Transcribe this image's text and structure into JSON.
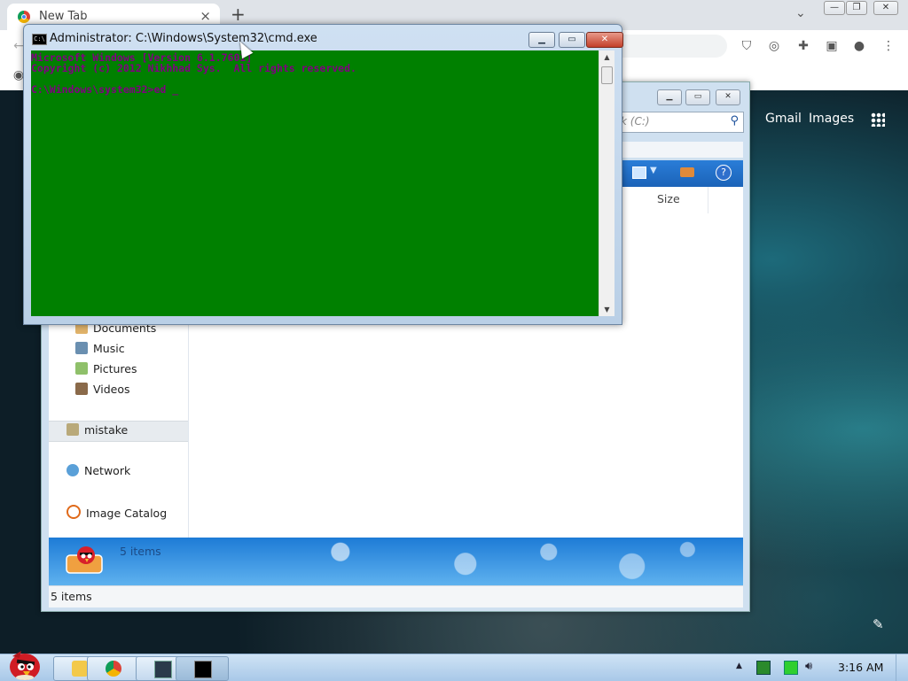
{
  "browser": {
    "tab_title": "New Tab",
    "tab_close": "×",
    "new_tab": "+",
    "tab_dropdown": "⌄",
    "ntp_links": [
      "Gmail",
      "Images"
    ]
  },
  "explorer": {
    "search_placeholder": "k (C:)",
    "column_size": "Size",
    "nav_items": [
      "Documents",
      "Music",
      "Pictures",
      "Videos",
      "mistake",
      "Network",
      "Image Catalog"
    ],
    "details_text": "5 items",
    "status_text": "5 items"
  },
  "cmd": {
    "title": "Administrator: C:\\Windows\\System32\\cmd.exe",
    "lines": [
      "Microsoft Windows [Version 6.1.7601]",
      "Copyright (c) 2012 Nikhhad Sys.  All rights reserved.",
      "",
      "C:\\Windows\\system32>ed _"
    ],
    "console_bg": "#008000",
    "console_fg": "#800080"
  },
  "taskbar": {
    "clock": "3:16 AM"
  }
}
